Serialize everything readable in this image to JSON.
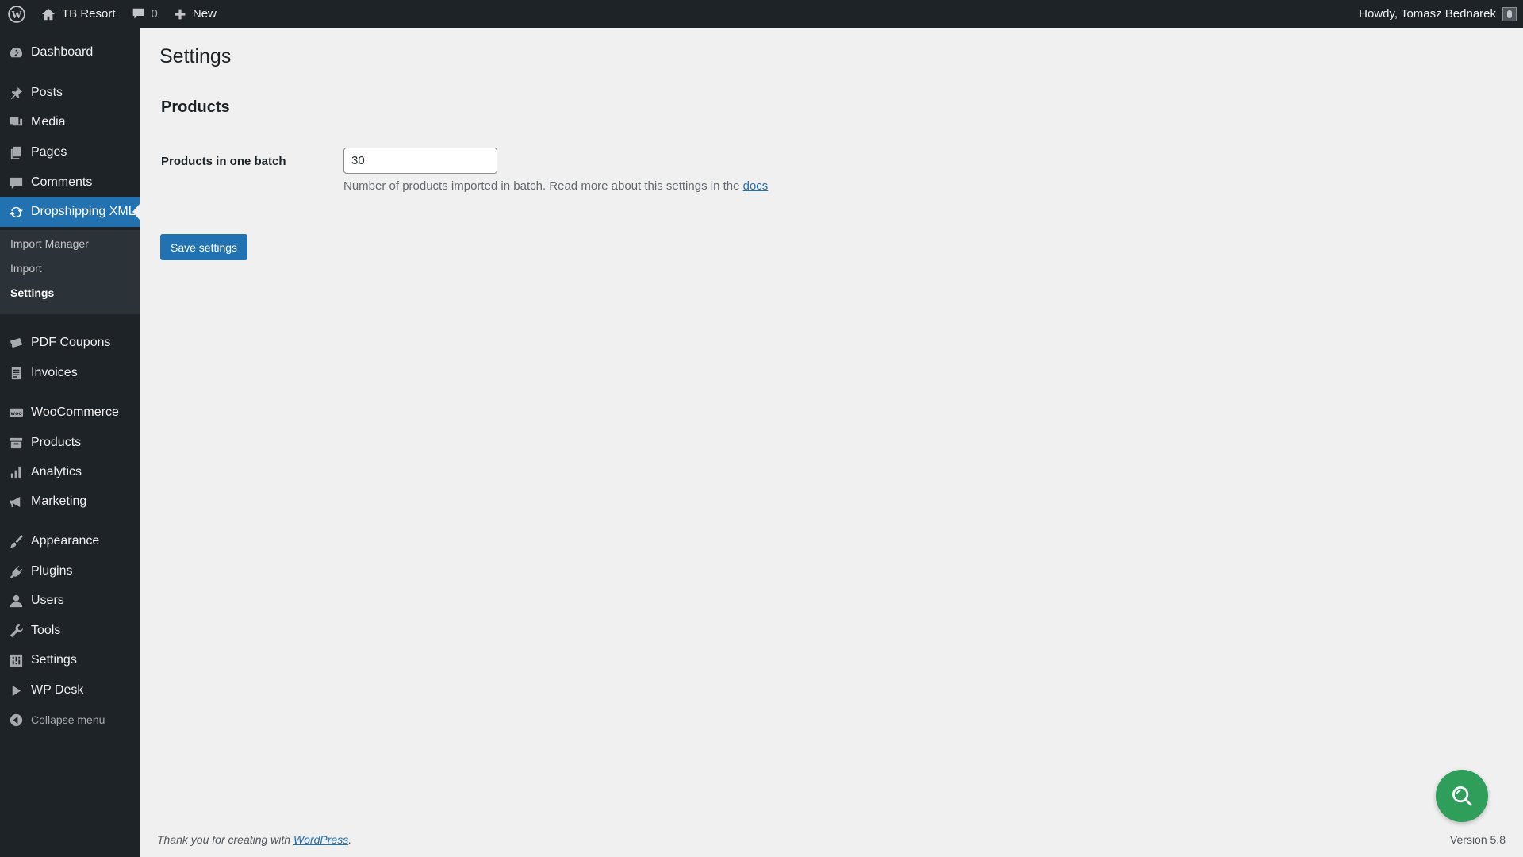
{
  "adminbar": {
    "site_name": "TB Resort",
    "comments_count": "0",
    "new_label": "New",
    "greeting": "Howdy, Tomasz Bednarek"
  },
  "sidebar": {
    "items": [
      {
        "label": "Dashboard",
        "icon": "dashboard-icon"
      },
      {
        "label": "Posts",
        "icon": "pushpin-icon"
      },
      {
        "label": "Media",
        "icon": "media-icon"
      },
      {
        "label": "Pages",
        "icon": "pages-icon"
      },
      {
        "label": "Comments",
        "icon": "comment-icon"
      },
      {
        "label": "Dropshipping XML",
        "icon": "sync-icon"
      },
      {
        "label": "PDF Coupons",
        "icon": "tickets-icon"
      },
      {
        "label": "Invoices",
        "icon": "invoice-icon"
      },
      {
        "label": "WooCommerce",
        "icon": "woocommerce-icon"
      },
      {
        "label": "Products",
        "icon": "archive-icon"
      },
      {
        "label": "Analytics",
        "icon": "bar-chart-icon"
      },
      {
        "label": "Marketing",
        "icon": "megaphone-icon"
      },
      {
        "label": "Appearance",
        "icon": "paintbrush-icon"
      },
      {
        "label": "Plugins",
        "icon": "plug-icon"
      },
      {
        "label": "Users",
        "icon": "user-icon"
      },
      {
        "label": "Tools",
        "icon": "wrench-icon"
      },
      {
        "label": "Settings",
        "icon": "sliders-icon"
      },
      {
        "label": "WP Desk",
        "icon": "play-icon"
      }
    ],
    "submenu": [
      "Import Manager",
      "Import",
      "Settings"
    ],
    "collapse_label": "Collapse menu"
  },
  "main": {
    "page_title": "Settings",
    "section_title": "Products",
    "field_label": "Products in one batch",
    "field_value": "30",
    "field_description": "Number of products imported in batch. Read more about this settings in the ",
    "docs_link": "docs",
    "save_label": "Save settings"
  },
  "footer": {
    "thanks_text": "Thank you for creating with ",
    "wp_link": "WordPress",
    "thanks_end": ".",
    "version": "Version 5.8"
  },
  "colors": {
    "sidebar_bg": "#1d2327",
    "accent": "#2271b1",
    "help_button": "#2f9e5b"
  }
}
